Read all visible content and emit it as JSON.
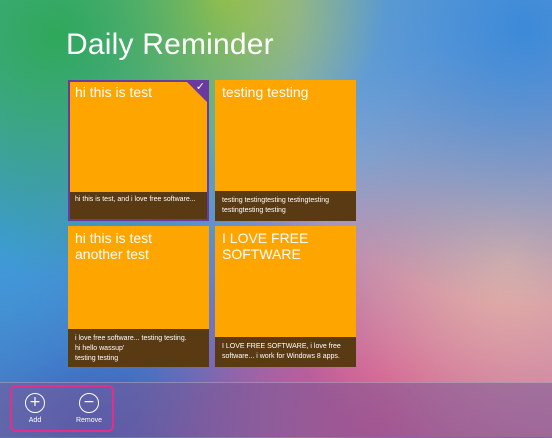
{
  "app": {
    "title": "Daily Reminder"
  },
  "tiles": [
    {
      "title": "hi this is test",
      "body": [
        "hi this is test, and i love free software..."
      ],
      "selected": true
    },
    {
      "title": "testing testing",
      "body": [
        "testing testingtesting testingtesting",
        "testingtesting testing"
      ],
      "selected": false
    },
    {
      "title": "hi this is test another test",
      "body": [
        "i love free software... testing testing.",
        "hi hello wassup'",
        "testing testing"
      ],
      "selected": false
    },
    {
      "title": "I LOVE FREE SOFTWARE",
      "body": [
        "I LOVE FREE SOFTWARE,  i love free",
        "software...     i work for Windows 8 apps."
      ],
      "selected": false
    }
  ],
  "appbar": {
    "add_label": "Add",
    "remove_label": "Remove",
    "add_icon": "add-icon",
    "remove_icon": "remove-icon"
  },
  "colors": {
    "tile": "#ffa500",
    "tile_body": "#5a3a12",
    "selection": "#6a3aa0",
    "highlight": "#e0308a"
  }
}
